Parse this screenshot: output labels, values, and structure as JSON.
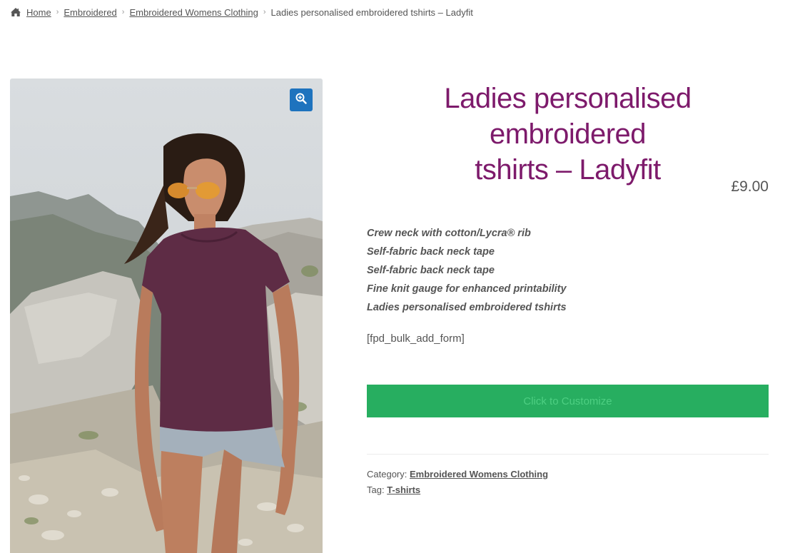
{
  "breadcrumb": {
    "home_icon": "home-icon",
    "items": [
      "Home",
      "Embroidered",
      "Embroidered Womens Clothing"
    ],
    "current": "Ladies personalised embroidered tshirts – Ladyfit"
  },
  "gallery": {
    "zoom_icon": "zoom-in-icon",
    "image_subject": "woman wearing purple t-shirt and sunglasses on rocky mountain"
  },
  "product": {
    "title_line1": "Ladies personalised embroidered",
    "title_line2": "tshirts – Ladyfit",
    "price": "£9.00",
    "features": [
      "Crew neck with cotton/Lycra® rib",
      "Self-fabric back neck tape",
      "Self-fabric back neck tape",
      "Fine knit gauge for enhanced printability",
      "Ladies personalised embroidered tshirts"
    ],
    "shortcode": "[fpd_bulk_add_form]",
    "customize_label": "Click to Customize"
  },
  "meta": {
    "category_label": "Category:",
    "category_value": "Embroidered Womens Clothing",
    "tag_label": "Tag:",
    "tag_value": "T-shirts"
  },
  "colors": {
    "title": "#7d1a6b",
    "customize_button": "#27ae60",
    "zoom_button": "#1e73be"
  }
}
